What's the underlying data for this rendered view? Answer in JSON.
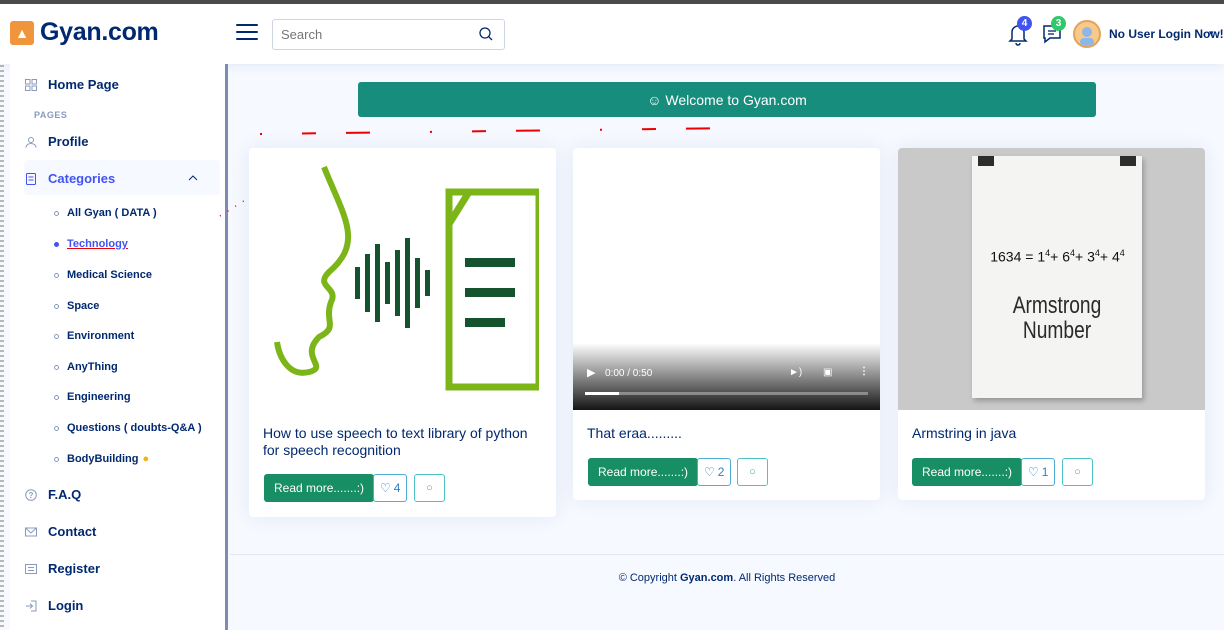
{
  "header": {
    "logo_text": "Gyan.com",
    "search_placeholder": "Search",
    "notifications_count": "4",
    "messages_count": "3",
    "user_name": "No User Login Now!"
  },
  "sidebar": {
    "home": "Home Page",
    "pages_heading": "PAGES",
    "profile": "Profile",
    "categories": "Categories",
    "sub_items": [
      "All Gyan ( DATA )",
      "Technology",
      "Medical Science",
      "Space",
      "Environment",
      "AnyThing",
      "Engineering",
      "Questions ( doubts-Q&A )",
      "BodyBuilding"
    ],
    "faq": "F.A.Q",
    "contact": "Contact",
    "register": "Register",
    "login": "Login"
  },
  "main": {
    "welcome": "☺ Welcome to Gyan.com",
    "cards": [
      {
        "title": "How to use speech to text library of python for speech recognition",
        "read_more": "Read more.......:)",
        "likes": "4"
      },
      {
        "title": "That eraa.........",
        "read_more": "Read more.......:)",
        "likes": "2",
        "video_time": "0:00 / 0:50",
        "video_progress": 0.12
      },
      {
        "title": "Armstring in java",
        "read_more": "Read more.......:)",
        "likes": "1",
        "poster_title": "Armstrong Number"
      }
    ]
  },
  "footer": {
    "prefix": "© Copyright ",
    "brand": "Gyan.com",
    "suffix": ". All Rights Reserved"
  },
  "colors": {
    "brand_navy": "#012970",
    "teal": "#178e7d",
    "green_btn": "#178e64",
    "accent_blue": "#4154f1"
  }
}
